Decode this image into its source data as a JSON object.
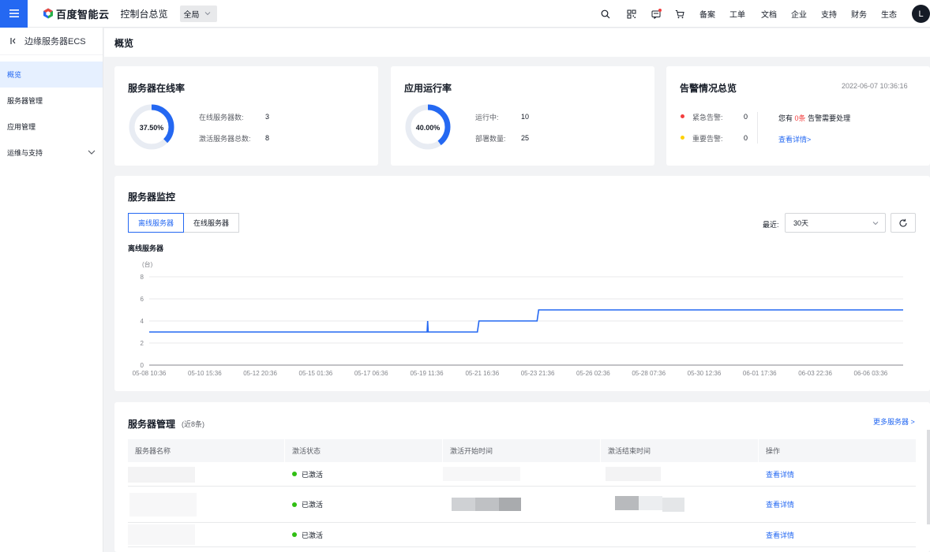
{
  "topbar": {
    "brand": "百度智能云",
    "console_title": "控制台总览",
    "region": "全局",
    "links": [
      "备案",
      "工单",
      "文档",
      "企业",
      "支持",
      "财务",
      "生态"
    ],
    "avatar_initial": "L"
  },
  "sidebar": {
    "title": "边缘服务器ECS",
    "items": [
      {
        "label": "概览"
      },
      {
        "label": "服务器管理"
      },
      {
        "label": "应用管理"
      },
      {
        "label": "运维与支持"
      }
    ]
  },
  "page_title": "概览",
  "online_card": {
    "title": "服务器在线率",
    "rate_label": "37.50%",
    "rate": 0.375,
    "rows": [
      {
        "label": "在线服务器数:",
        "value": "3"
      },
      {
        "label": "激活服务器总数:",
        "value": "8"
      }
    ]
  },
  "app_card": {
    "title": "应用运行率",
    "rate_label": "40.00%",
    "rate": 0.4,
    "rows": [
      {
        "label": "运行中:",
        "value": "10"
      },
      {
        "label": "部署数量:",
        "value": "25"
      }
    ]
  },
  "alert_card": {
    "title": "告警情况总览",
    "timestamp": "2022-06-07 10:36:16",
    "rows": [
      {
        "label": "紧急告警:",
        "value": "0",
        "color": "#f33e3e"
      },
      {
        "label": "重要告警:",
        "value": "0",
        "color": "#ffd100"
      }
    ],
    "notice_prefix": "您有",
    "notice_count": "0条",
    "notice_suffix": "告警需要处理",
    "details_link": "查看详情>"
  },
  "monitor": {
    "title": "服务器监控",
    "tabs": [
      "离线服务器",
      "在线服务器"
    ],
    "range_label": "最近:",
    "range_value": "30天",
    "chart_title": "离线服务器",
    "unit": "(台)"
  },
  "chart_data": {
    "type": "line",
    "title": "离线服务器",
    "ylabel": "(台)",
    "ylim": [
      0,
      8
    ],
    "yticks": [
      "0",
      "2",
      "4",
      "6",
      "8"
    ],
    "x_tick_labels": [
      "05-08 10:36",
      "05-10 15:36",
      "05-12 20:36",
      "05-15 01:36",
      "05-17 06:36",
      "05-19 11:36",
      "05-21 16:36",
      "05-23 21:36",
      "05-26 02:36",
      "05-28 07:36",
      "05-30 12:36",
      "06-01 17:36",
      "06-03 22:36",
      "06-06 03:36"
    ],
    "grid": true,
    "color": "#2468f2",
    "series": [
      {
        "points": [
          [
            "05-08 10:36",
            3
          ],
          [
            "05-19 12:00",
            3
          ],
          [
            "05-19 12:30",
            4
          ],
          [
            "05-19 13:00",
            3
          ],
          [
            "05-21 12:00",
            3
          ],
          [
            "05-21 13:30",
            4
          ],
          [
            "05-23 21:00",
            4
          ],
          [
            "05-23 22:30",
            5
          ],
          [
            "06-07 10:36",
            5
          ]
        ]
      }
    ]
  },
  "server_table": {
    "title": "服务器管理",
    "subtitle": "(近8条)",
    "more_link": "更多服务器 >",
    "columns": [
      "服务器名称",
      "激活状态",
      "激活开始时间",
      "激活结束时间",
      "操作"
    ],
    "rows": [
      {
        "status": "已激活",
        "action": "查看详情"
      },
      {
        "status": "已激活",
        "action": "查看详情"
      },
      {
        "status": "已激活",
        "action": "查看详情"
      }
    ]
  }
}
